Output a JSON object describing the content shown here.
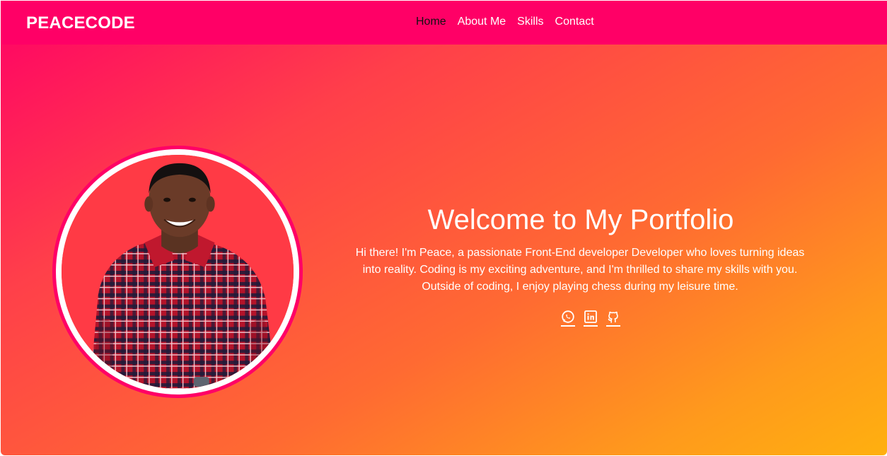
{
  "brand": "PEACECODE",
  "nav": {
    "items": [
      {
        "label": "Home",
        "active": true
      },
      {
        "label": "About Me",
        "active": false
      },
      {
        "label": "Skills",
        "active": false
      },
      {
        "label": "Contact",
        "active": false
      }
    ]
  },
  "hero": {
    "title": "Welcome to My Portfolio",
    "intro": "Hi there! I'm Peace, a passionate Front-End developer Developer who loves turning ideas into reality. Coding is my exciting adventure, and I'm thrilled to share my skills with you. Outside of coding, I enjoy playing chess during my leisure time."
  },
  "social_icons": [
    "whatsapp-icon",
    "linkedin-icon",
    "github-icon"
  ],
  "colors": {
    "navbar": "#ff0066",
    "gradient_start": "#ff0066",
    "gradient_end": "#ffb00f",
    "active_link": "#111111",
    "text": "#ffffff"
  }
}
